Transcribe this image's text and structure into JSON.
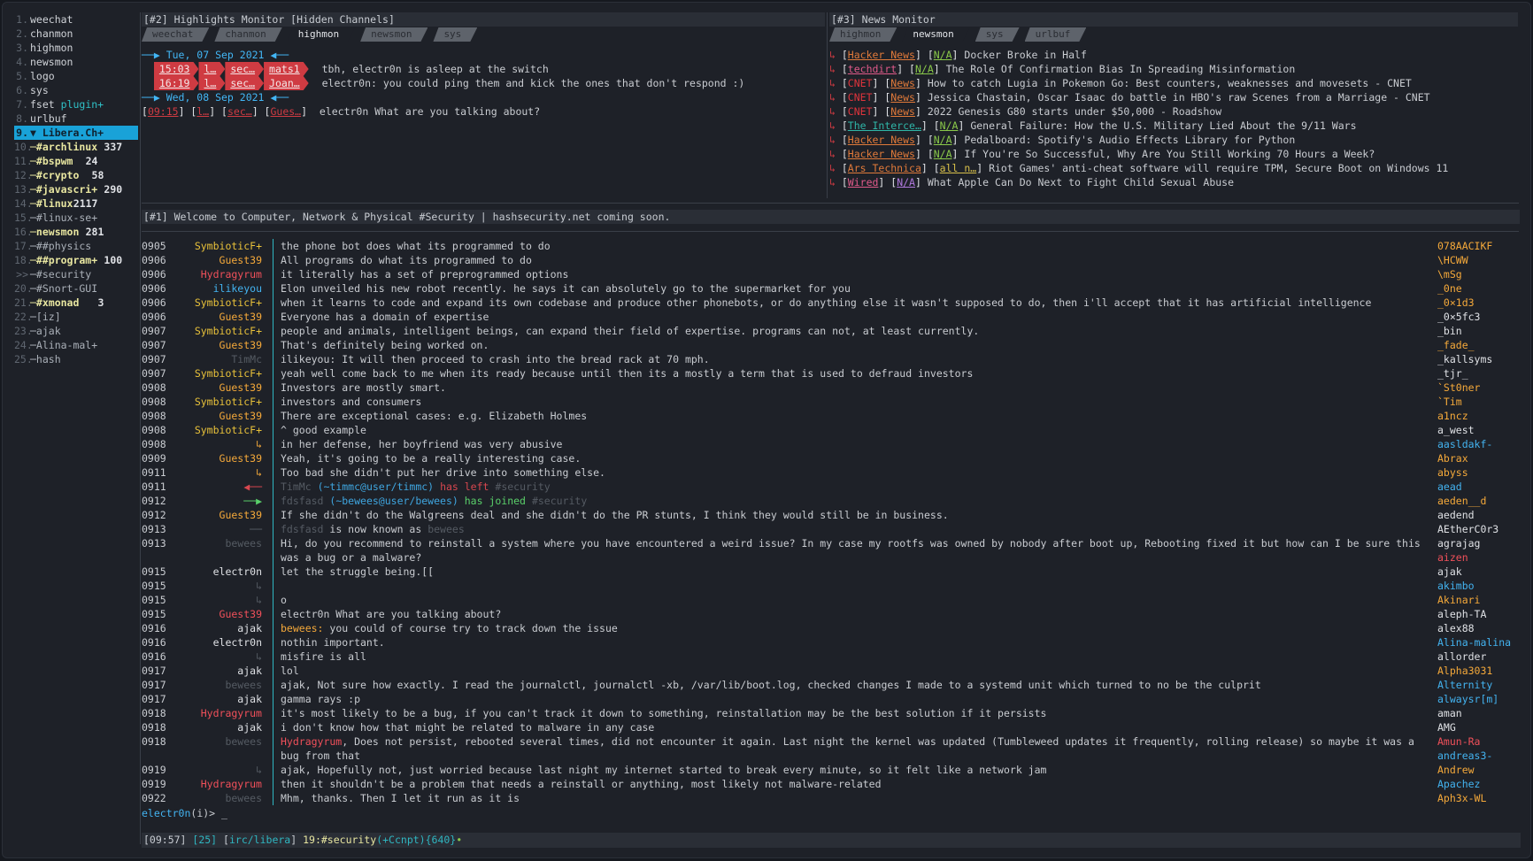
{
  "buflist": [
    {
      "num": "1.",
      "name": "weechat",
      "count": "",
      "cls": "bl-name"
    },
    {
      "num": "2.",
      "name": "chanmon",
      "count": "",
      "cls": "bl-name"
    },
    {
      "num": "3.",
      "name": "highmon",
      "count": "",
      "cls": "bl-name"
    },
    {
      "num": "4.",
      "name": "newsmon",
      "count": "",
      "cls": "bl-name"
    },
    {
      "num": "5.",
      "name": "logo",
      "count": "",
      "cls": "bl-name"
    },
    {
      "num": "6.",
      "name": "sys",
      "count": "",
      "cls": "bl-name"
    },
    {
      "num": "7.",
      "name": "fset",
      "extra": "plugin+",
      "count": "",
      "cls": "bl-name"
    },
    {
      "num": "8.",
      "name": "urlbuf",
      "count": "",
      "cls": "bl-name"
    },
    {
      "num": "9.",
      "name": "▼ Libera.Ch+",
      "count": "",
      "cls": "bl-name",
      "active": true
    },
    {
      "num": "10.",
      "name": "─#archlinux",
      "count": "337",
      "cls": "ch-hot"
    },
    {
      "num": "11.",
      "name": "─#bspwm",
      "count": "24",
      "cls": "ch-hot"
    },
    {
      "num": "12.",
      "name": "─#crypto",
      "count": "58",
      "cls": "ch-hot"
    },
    {
      "num": "13.",
      "name": "─#javascri+",
      "count": "290",
      "cls": "ch-hot"
    },
    {
      "num": "14.",
      "name": "─#linux",
      "count": "2117",
      "cls": "ch-hot"
    },
    {
      "num": "15.",
      "name": "─#linux-se+",
      "count": "",
      "cls": "ch-dim"
    },
    {
      "num": "16.",
      "name": "─newsmon",
      "count": "281",
      "cls": "ch-hot"
    },
    {
      "num": "17.",
      "name": "─##physics",
      "count": "",
      "cls": "ch-dim"
    },
    {
      "num": "18.",
      "name": "─##program+",
      "count": "100",
      "cls": "ch-hot"
    },
    {
      "num": ">>",
      "name": "─#security",
      "count": "",
      "cls": "ch-dim"
    },
    {
      "num": "20.",
      "name": "─#Snort-GUI",
      "count": "",
      "cls": "ch-dim"
    },
    {
      "num": "21.",
      "name": "─#xmonad",
      "count": "3",
      "cls": "ch-hot"
    },
    {
      "num": "22.",
      "name": "─[iz]",
      "count": "",
      "cls": "ch-dim"
    },
    {
      "num": "23.",
      "name": "─ajak",
      "count": "",
      "cls": "ch-dim"
    },
    {
      "num": "24.",
      "name": "─Alina-mal+",
      "count": "",
      "cls": "ch-dim"
    },
    {
      "num": "25.",
      "name": "─hash",
      "count": "",
      "cls": "ch-dim"
    }
  ],
  "highlights": {
    "title": "[#2] Highlights Monitor [Hidden Channels]",
    "tabs": [
      "weechat",
      "chanmon",
      "highmon",
      "newsmon",
      "sys"
    ],
    "active_tab": 2,
    "date1": "──▶ Tue, 07 Sep 2021 ◀──",
    "rows1": [
      {
        "time": "15:03",
        "a": "l…",
        "b": "sec…",
        "c": "mats1",
        "msg": "tbh, electr0n is asleep at the switch"
      },
      {
        "time": "16:19",
        "a": "l…",
        "b": "sec…",
        "c": "Joan…",
        "msg": "electr0n: you could ping them and kick the ones that don't respond :)"
      }
    ],
    "date2": "──▶ Wed, 08 Sep 2021 ◀──",
    "row3": {
      "time": "09:15",
      "a": "l…",
      "b": "sec…",
      "c": "Gues…",
      "msg": "electr0n What are you talking about?"
    }
  },
  "news": {
    "title": "[#3] News Monitor",
    "tabs": [
      "highmon",
      "newsmon",
      "sys",
      "urlbuf"
    ],
    "active_tab": 1,
    "items": [
      {
        "src": "Hacker News",
        "tag": "N/A",
        "text": "Docker Broke in Half",
        "sc": "src",
        "tc": "tag-green"
      },
      {
        "src": "techdirt",
        "tag": "N/A",
        "text": "The Role Of Confirmation Bias In Spreading Misinformation",
        "sc": "src-pink",
        "tc": "tag-green"
      },
      {
        "src": "CNET",
        "tag": "News",
        "text": "How to catch Lugia in Pokemon Go: Best counters, weaknesses and movesets - CNET",
        "sc": "src-cnet",
        "tc": "tag"
      },
      {
        "src": "CNET",
        "tag": "News",
        "text": "Jessica Chastain, Oscar Isaac do battle in HBO's raw Scenes from a Marriage - CNET",
        "sc": "src-cnet",
        "tc": "tag"
      },
      {
        "src": "CNET",
        "tag": "News",
        "text": "2022 Genesis G80 starts under $50,000 - Roadshow",
        "sc": "src-cnet",
        "tc": "tag"
      },
      {
        "src": "The Interce…",
        "tag": "N/A",
        "text": "General Failure: How the U.S. Military Lied About the 9/11 Wars",
        "sc": "src-teal",
        "tc": "tag-green"
      },
      {
        "src": "Hacker News",
        "tag": "N/A",
        "text": "Pedalboard: Spotify's Audio Effects Library for Python",
        "sc": "src",
        "tc": "tag-green"
      },
      {
        "src": "Hacker News",
        "tag": "N/A",
        "text": "If You're So Successful, Why Are You Still Working 70 Hours a Week?",
        "sc": "src",
        "tc": "tag-green"
      },
      {
        "src": "Ars Technica",
        "tag": "all n…",
        "text": "Riot Games' anti-cheat software will require TPM, Secure Boot on Windows 11",
        "sc": "src",
        "tc": "tag-yellow"
      },
      {
        "src": "Wired",
        "tag": "N/A",
        "text": "What Apple Can Do Next to Fight Child Sexual Abuse",
        "sc": "src-pink",
        "tc": "tag-purple"
      }
    ]
  },
  "chat": {
    "title": "[#1] Welcome to Computer, Network & Physical #Security | hashsecurity.net coming soon.",
    "messages": [
      {
        "t": "0905",
        "nick": "SymbioticF+",
        "nc": "n-sym",
        "text": "the phone bot does what its programmed to do"
      },
      {
        "t": "0906",
        "nick": "Guest39",
        "nc": "n-orange",
        "text": "All programs do what its programmed to do"
      },
      {
        "t": "0906",
        "nick": "Hydragyrum",
        "nc": "n-red",
        "text": "it literally has a set of preprogrammed options"
      },
      {
        "t": "0906",
        "nick": "ilikeyou",
        "nc": "n-blue",
        "text": "Elon unveiled his new robot recently. he says it can absolutely go to the supermarket for you"
      },
      {
        "t": "0906",
        "nick": "SymbioticF+",
        "nc": "n-sym",
        "text": "when it learns to code and expand its own codebase and produce other phonebots, or do anything else it wasn't supposed to do, then i'll accept that it has artificial intelligence"
      },
      {
        "t": "0906",
        "nick": "Guest39",
        "nc": "n-orange",
        "text": "Everyone has a domain of expertise"
      },
      {
        "t": "0907",
        "nick": "SymbioticF+",
        "nc": "n-sym",
        "text": "people and animals, intelligent beings, can expand their field of expertise. programs can not, at least currently."
      },
      {
        "t": "0907",
        "nick": "Guest39",
        "nc": "n-orange",
        "text": "That's definitely being worked on."
      },
      {
        "t": "0907",
        "nick": "TimMc",
        "nc": "n-grey",
        "text": "ilikeyou: It will then proceed to crash into the bread rack at 70 mph."
      },
      {
        "t": "0907",
        "nick": "SymbioticF+",
        "nc": "n-sym",
        "text": "yeah well come back to me when its ready because until then its a mostly a term that is used to defraud investors"
      },
      {
        "t": "0908",
        "nick": "Guest39",
        "nc": "n-orange",
        "text": "Investors are mostly smart."
      },
      {
        "t": "0908",
        "nick": "SymbioticF+",
        "nc": "n-sym",
        "text": "investors and consumers"
      },
      {
        "t": "0908",
        "nick": "Guest39",
        "nc": "n-orange",
        "text": "There are exceptional cases: e.g. Elizabeth Holmes"
      },
      {
        "t": "0908",
        "nick": "SymbioticF+",
        "nc": "n-sym",
        "text": "^ good example"
      },
      {
        "t": "0908",
        "nick": "↳",
        "nc": "n-orange",
        "text": "in her defense, her boyfriend was very abusive"
      },
      {
        "t": "0909",
        "nick": "Guest39",
        "nc": "n-orange",
        "text": "Yeah, it's going to be a really interesting case."
      },
      {
        "t": "0911",
        "nick": "↳",
        "nc": "n-orange",
        "text": "Too bad she didn't put her drive into something else."
      },
      {
        "t": "0911",
        "nick": "◀──",
        "nc": "n-part",
        "kind": "part",
        "who": "TimMc",
        "host": "(~timmc@user/timmc)",
        "action": "has left",
        "chan": "#security"
      },
      {
        "t": "0912",
        "nick": "──▶",
        "nc": "n-join",
        "kind": "join",
        "who": "fdsfasd",
        "host": "(~bewees@user/bewees)",
        "action": "has joined",
        "chan": "#security"
      },
      {
        "t": "0912",
        "nick": "Guest39",
        "nc": "n-orange",
        "text": "If she didn't do the Walgreens deal and she didn't do the PR stunts, I think they would still be in business."
      },
      {
        "t": "0913",
        "nick": "──",
        "nc": "n-grey",
        "kind": "nickchg",
        "who": "fdsfasd",
        "action": "is now known as",
        "newnick": "bewees"
      },
      {
        "t": "0913",
        "nick": "bewees",
        "nc": "n-grey",
        "wrap": true,
        "text": "Hi, do you recommend to reinstall a system where you have encountered a weird issue? In my case my rootfs was owned by nobody after boot up, Rebooting fixed it but how can I be sure this was a bug or a malware?"
      },
      {
        "t": "0915",
        "nick": "electr0n",
        "nc": "n-white",
        "text": "let the struggle being.[["
      },
      {
        "t": "0915",
        "nick": "↳",
        "nc": "n-grey",
        "text": ""
      },
      {
        "t": "0915",
        "nick": "↳",
        "nc": "n-grey",
        "text": "o"
      },
      {
        "t": "0915",
        "nick": "Guest39",
        "nc": "n-red",
        "text": "electr0n What are you talking about?"
      },
      {
        "t": "0916",
        "nick": "ajak",
        "nc": "n-white",
        "hl": "bewees:",
        "text": " you could of course try to track down the issue"
      },
      {
        "t": "0916",
        "nick": "electr0n",
        "nc": "n-white",
        "text": "nothin important."
      },
      {
        "t": "0916",
        "nick": "↳",
        "nc": "n-grey",
        "text": "misfire is all"
      },
      {
        "t": "0917",
        "nick": "ajak",
        "nc": "n-white",
        "text": "lol"
      },
      {
        "t": "0917",
        "nick": "bewees",
        "nc": "n-grey",
        "text": "ajak, Not sure how exactly. I read the journalctl, journalctl -xb, /var/lib/boot.log, checked changes I made to a systemd unit which turned to no be the culprit"
      },
      {
        "t": "0917",
        "nick": "ajak",
        "nc": "n-white",
        "text": "gamma rays :p"
      },
      {
        "t": "0918",
        "nick": "Hydragyrum",
        "nc": "n-red",
        "text": "it's most likely to be a bug, if you can't track it down to something, reinstallation may be the best solution if it persists"
      },
      {
        "t": "0918",
        "nick": "ajak",
        "nc": "n-white",
        "text": "i don't know how that might be related to malware in any case"
      },
      {
        "t": "0918",
        "nick": "bewees",
        "nc": "n-grey",
        "wrap": true,
        "hlred": "Hydragyrum",
        "text": ", Does not persist, rebooted several times, did not encounter it again. Last night the kernel was updated (Tumbleweed updates it frequently, rolling release) so maybe it was a bug from that"
      },
      {
        "t": "0919",
        "nick": "↳",
        "nc": "n-grey",
        "text": "ajak, Hopefully not, just worried because last night my internet started to break every minute, so it felt like a network jam"
      },
      {
        "t": "0919",
        "nick": "Hydragyrum",
        "nc": "n-red",
        "text": "then it shouldn't be a problem that needs a reinstall or anything, most likely not malware-related"
      },
      {
        "t": "0922",
        "nick": "bewees",
        "nc": "n-grey",
        "text": "Mhm, thanks. Then I let it run as it is"
      }
    ]
  },
  "nicklist": [
    {
      "n": "078AACIKF",
      "c": "nk-o"
    },
    {
      "n": "\\HCWW",
      "c": "nk-o"
    },
    {
      "n": "\\mSg",
      "c": "nk-o"
    },
    {
      "n": "_0ne",
      "c": "nk-o"
    },
    {
      "n": "_0×1d3",
      "c": "nk-o"
    },
    {
      "n": "_0×5fc3",
      "c": "nk-w"
    },
    {
      "n": "_bin",
      "c": "nk-w"
    },
    {
      "n": "_fade_",
      "c": "nk-o"
    },
    {
      "n": "_kallsyms",
      "c": "nk-w"
    },
    {
      "n": "_tjr_",
      "c": "nk-w"
    },
    {
      "n": "`St0ner",
      "c": "nk-o"
    },
    {
      "n": "`Tim",
      "c": "nk-o"
    },
    {
      "n": "a1ncz",
      "c": "nk-o"
    },
    {
      "n": "a_west",
      "c": "nk-w"
    },
    {
      "n": "aasldakf-",
      "c": "nk-b"
    },
    {
      "n": "Abrax",
      "c": "nk-o"
    },
    {
      "n": "abyss",
      "c": "nk-o"
    },
    {
      "n": "aead",
      "c": "nk-b"
    },
    {
      "n": "aeden__d",
      "c": "nk-o"
    },
    {
      "n": "aedend",
      "c": "nk-w"
    },
    {
      "n": "AEtherC0r3",
      "c": "nk-w"
    },
    {
      "n": "agrajag",
      "c": "nk-w"
    },
    {
      "n": "aizen",
      "c": "nk-r"
    },
    {
      "n": "ajak",
      "c": "nk-w"
    },
    {
      "n": "akimbo",
      "c": "nk-b"
    },
    {
      "n": "Akinari",
      "c": "nk-o"
    },
    {
      "n": "aleph-TA",
      "c": "nk-w"
    },
    {
      "n": "alex88",
      "c": "nk-w"
    },
    {
      "n": "Alina-malina",
      "c": "nk-b"
    },
    {
      "n": "allorder",
      "c": "nk-w"
    },
    {
      "n": "Alpha3031",
      "c": "nk-o"
    },
    {
      "n": "Alternity",
      "c": "nk-b"
    },
    {
      "n": "alwaysr[m]",
      "c": "nk-b"
    },
    {
      "n": "aman",
      "c": "nk-w"
    },
    {
      "n": "AMG",
      "c": "nk-w"
    },
    {
      "n": "Amun-Ra",
      "c": "nk-r"
    },
    {
      "n": "andreas3-",
      "c": "nk-b"
    },
    {
      "n": "Andrew",
      "c": "nk-o"
    },
    {
      "n": "Apachez",
      "c": "nk-b"
    },
    {
      "n": "Aph3x-WL",
      "c": "nk-o"
    }
  ],
  "input": {
    "nick": "electr0n",
    "mode": "(i)>",
    "cursor": "_"
  },
  "status": {
    "time": "[09:57]",
    "num": "[25]",
    "net": "irc/libera",
    "buf": "19:#security",
    "modes": "(+Ccnpt){640}",
    "dot": "•"
  }
}
